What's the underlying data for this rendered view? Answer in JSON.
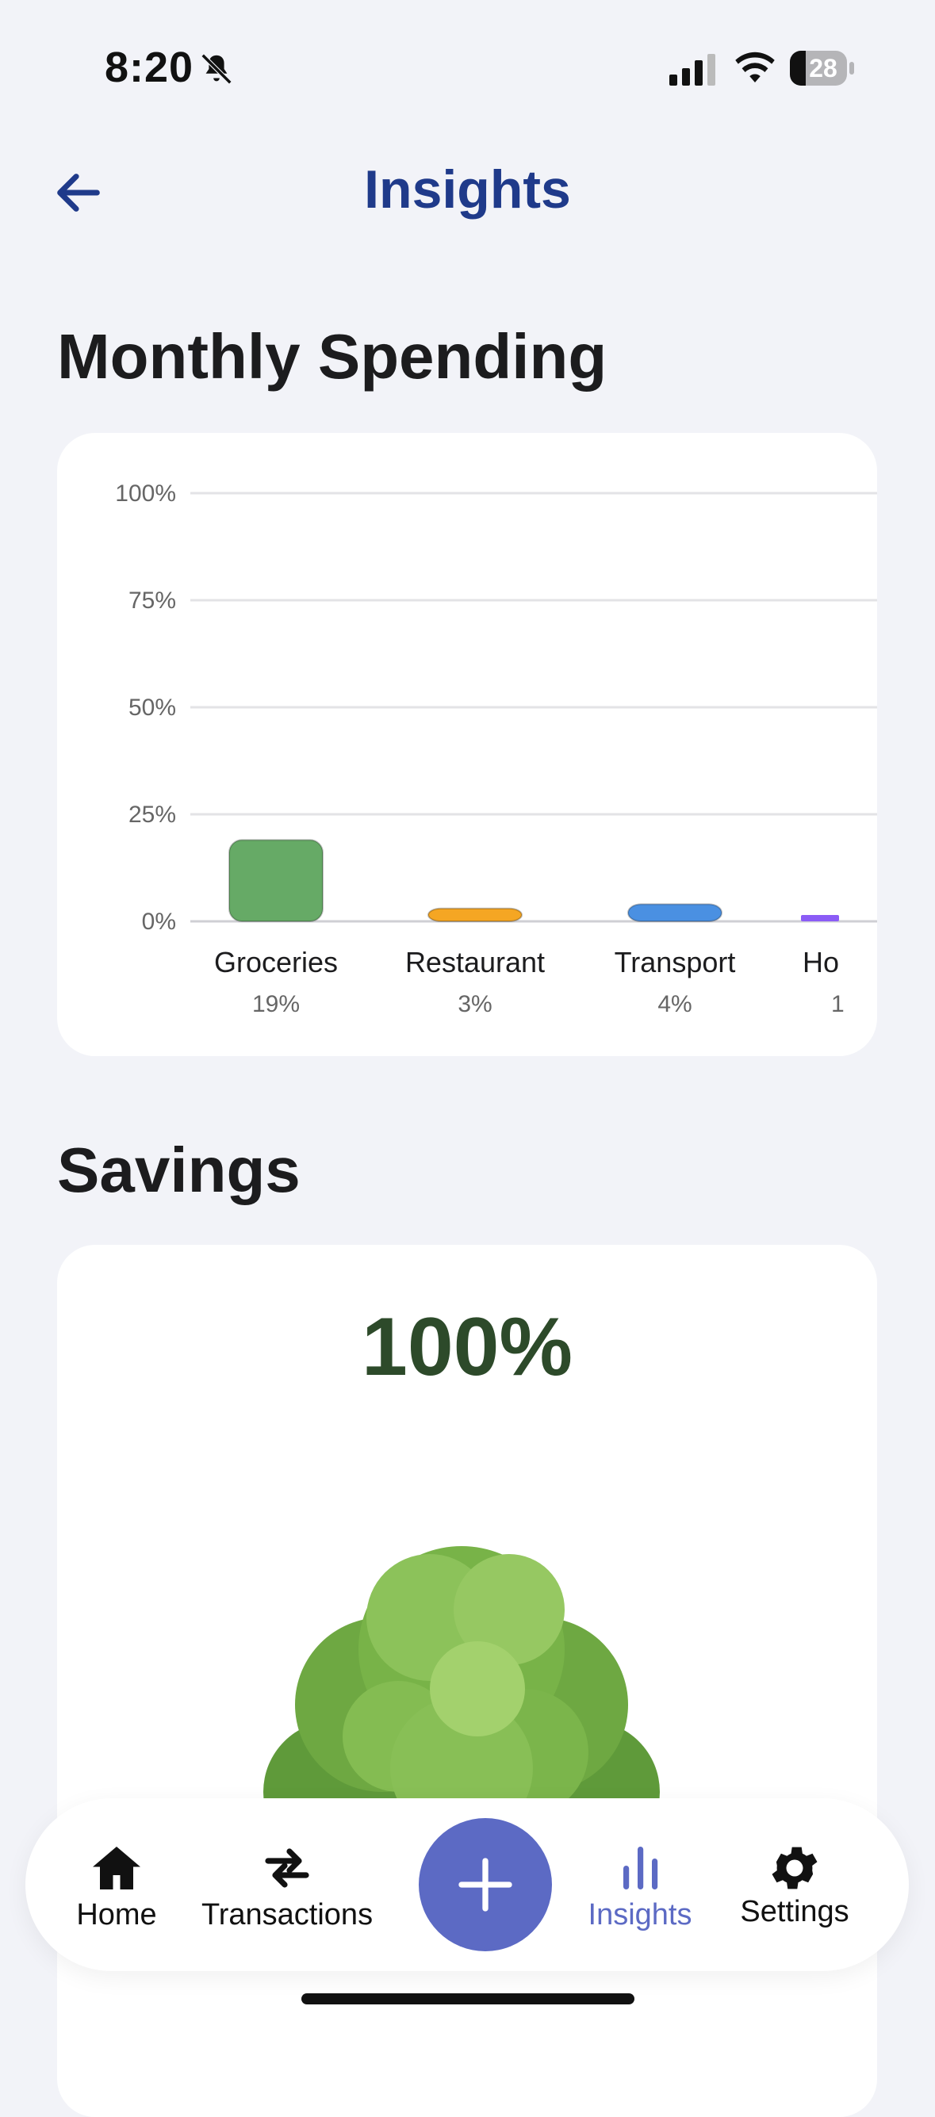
{
  "status": {
    "time": "8:20",
    "battery": "28"
  },
  "header": {
    "title": "Insights"
  },
  "spending": {
    "section_title": "Monthly Spending"
  },
  "savings": {
    "section_title": "Savings",
    "percent": "100%"
  },
  "chart_data": {
    "type": "bar",
    "ylim": [
      0,
      100
    ],
    "yticks": [
      "100%",
      "75%",
      "50%",
      "25%",
      "0%"
    ],
    "ytick_values": [
      100,
      75,
      50,
      25,
      0
    ],
    "grid": true,
    "categories": [
      "Groceries",
      "Restaurant",
      "Transport",
      "Ho"
    ],
    "values": [
      19,
      3,
      4,
      1
    ],
    "value_labels": [
      "19%",
      "3%",
      "4%",
      "1"
    ],
    "colors": [
      "#66aa66",
      "#f5a623",
      "#4a90e2",
      "#8b5cf6"
    ]
  },
  "nav": {
    "items": [
      {
        "label": "Home",
        "icon": "home-icon"
      },
      {
        "label": "Transactions",
        "icon": "transfer-icon"
      },
      {
        "label": "Insights",
        "icon": "bar-chart-icon",
        "active": true
      },
      {
        "label": "Settings",
        "icon": "gear-icon"
      }
    ],
    "add_icon": "plus-icon"
  },
  "colors": {
    "accent": "#5c6ac4",
    "title": "#1f3a8a",
    "savings": "#2d4a2a"
  }
}
